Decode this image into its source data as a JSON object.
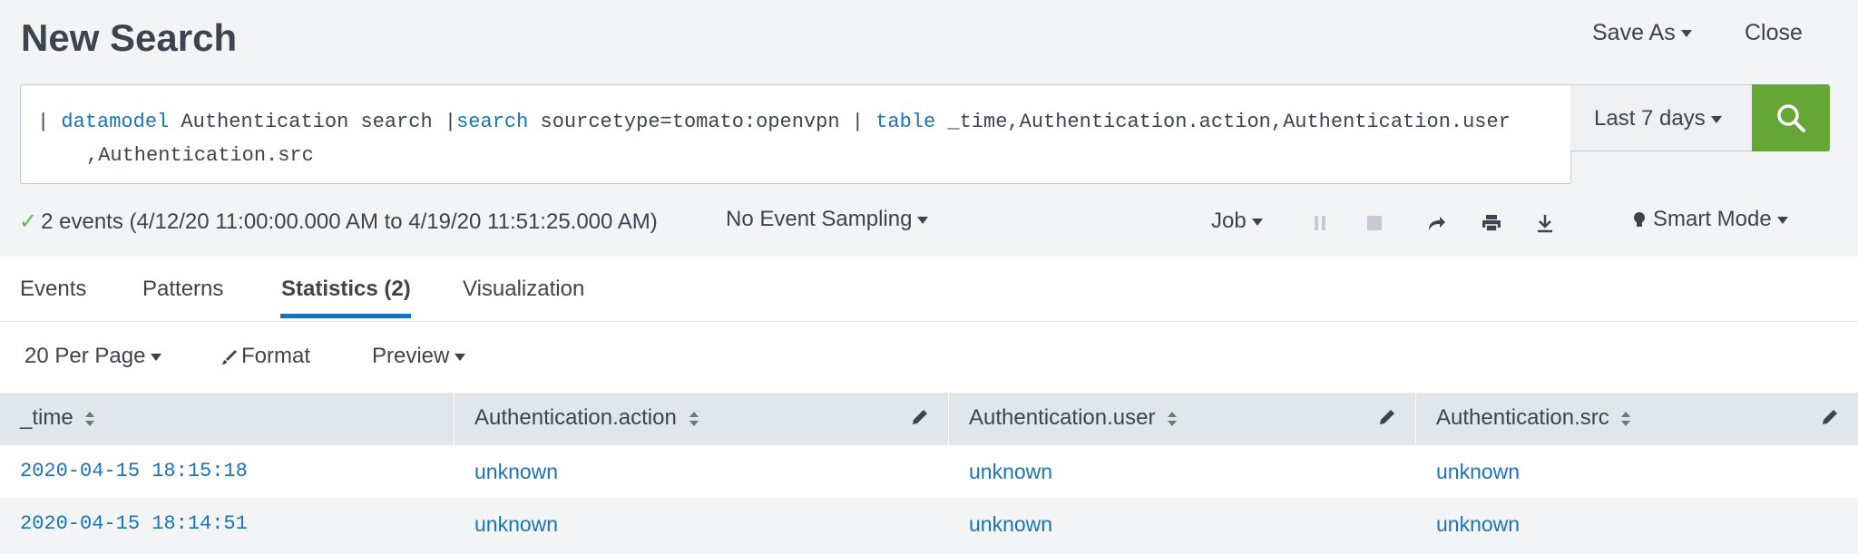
{
  "header": {
    "title": "New Search",
    "save_as": "Save As",
    "close": "Close"
  },
  "search": {
    "query_parts": [
      {
        "t": "| ",
        "kw": false
      },
      {
        "t": "datamodel",
        "kw": true
      },
      {
        "t": " Authentication search |",
        "kw": false
      },
      {
        "t": "search",
        "kw": true
      },
      {
        "t": " sourcetype=tomato:openvpn | ",
        "kw": false
      },
      {
        "t": "table",
        "kw": true
      },
      {
        "t": " _time,Authentication.action,Authentication.user",
        "kw": false
      }
    ],
    "query_line2": ",Authentication.src",
    "time_range": "Last 7 days"
  },
  "status": {
    "events": "2 events (4/12/20 11:00:00.000 AM to 4/19/20 11:51:25.000 AM)",
    "sampling": "No Event Sampling",
    "job": "Job",
    "mode": "Smart Mode"
  },
  "tabs": [
    {
      "label": "Events",
      "active": false
    },
    {
      "label": "Patterns",
      "active": false
    },
    {
      "label": "Statistics (2)",
      "active": true
    },
    {
      "label": "Visualization",
      "active": false
    }
  ],
  "toolbar": {
    "per_page": "20 Per Page",
    "format": "Format",
    "preview": "Preview"
  },
  "table": {
    "columns": [
      "_time",
      "Authentication.action",
      "Authentication.user",
      "Authentication.src"
    ],
    "rows": [
      [
        "2020-04-15 18:15:18",
        "unknown",
        "unknown",
        "unknown"
      ],
      [
        "2020-04-15 18:14:51",
        "unknown",
        "unknown",
        "unknown"
      ]
    ]
  },
  "colors": {
    "accent": "#1a73b8",
    "search_button": "#65a637",
    "check": "#5cb85c"
  }
}
